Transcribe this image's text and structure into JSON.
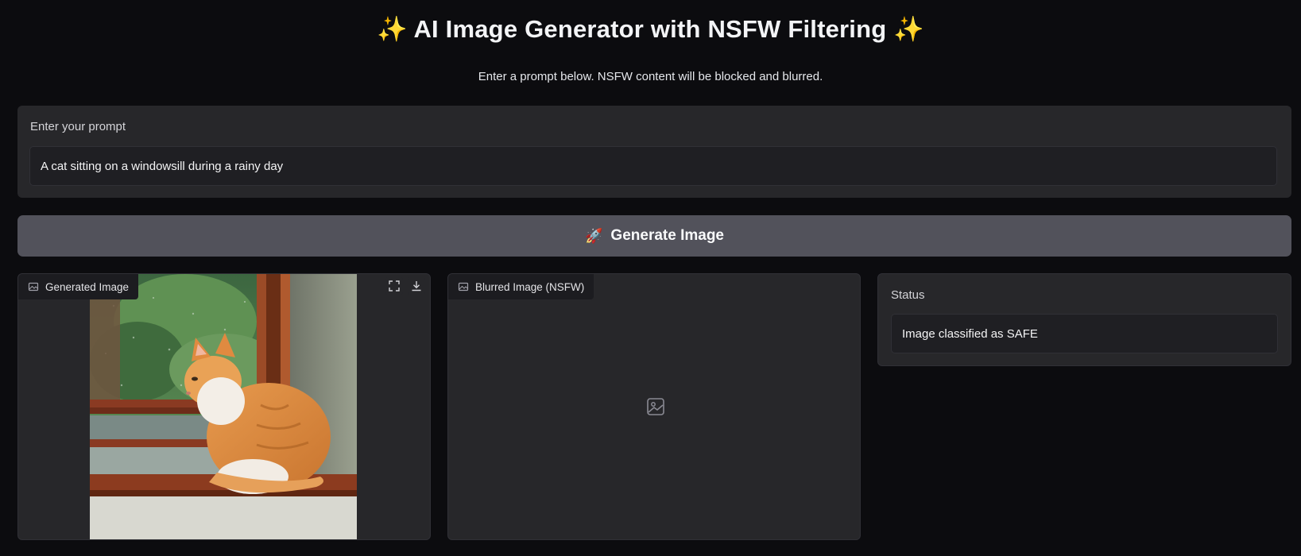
{
  "header": {
    "title_text": "AI Image Generator with NSFW Filtering",
    "title_emoji": "✨",
    "subtitle": "Enter a prompt below. NSFW content will be blocked and blurred."
  },
  "prompt": {
    "label": "Enter your prompt",
    "value": "A cat sitting on a windowsill during a rainy day"
  },
  "generate_button": {
    "icon": "rocket-icon",
    "label": "Generate Image"
  },
  "generated_panel": {
    "label": "Generated Image",
    "tools": [
      "fullscreen-icon",
      "download-icon"
    ]
  },
  "blurred_panel": {
    "label": "Blurred Image (NSFW)",
    "empty_icon": "image-placeholder-icon"
  },
  "status_panel": {
    "label": "Status",
    "value": "Image classified as SAFE"
  },
  "colors": {
    "background": "#0c0c0f",
    "panel": "#27272a",
    "button": "#52525b",
    "accent_sparkle": "#f5c518"
  }
}
